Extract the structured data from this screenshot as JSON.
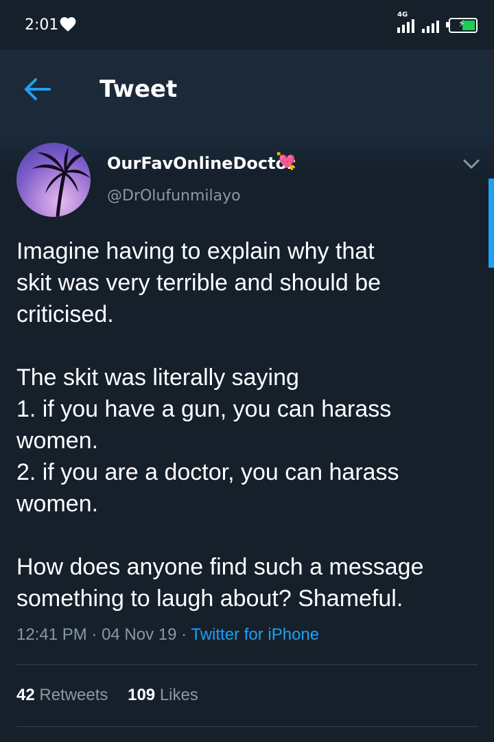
{
  "status_bar": {
    "time": "2:01",
    "network": "4G",
    "icons": [
      "heart-icon",
      "signal-icon",
      "battery-charging-icon"
    ]
  },
  "header": {
    "title": "Tweet",
    "back_icon": "arrow-left-icon"
  },
  "tweet": {
    "author_name": "OurFavOnlineDoctor",
    "author_emoji": "💘 ",
    "handle": "@DrOlufunmilayo",
    "text_lines": [
      "Imagine having to explain why that",
      "skit was very terrible and should be",
      "criticised.",
      "",
      "The skit was literally saying",
      "1. if you have a gun, you can harass",
      "women.",
      "2. if you are a doctor, you can harass",
      "women.",
      "",
      "How does anyone find such a message",
      "something to laugh about? Shameful."
    ],
    "time": "12:41 PM",
    "date": "04 Nov 19",
    "separator": " · ",
    "source": "Twitter for iPhone",
    "retweets_count": "42",
    "retweets_label": "Retweets",
    "likes_count": "109",
    "likes_label": "Likes"
  },
  "colors": {
    "background": "#15202b",
    "header": "#1c2938",
    "accent": "#1da1f2",
    "muted": "#8899a6"
  }
}
